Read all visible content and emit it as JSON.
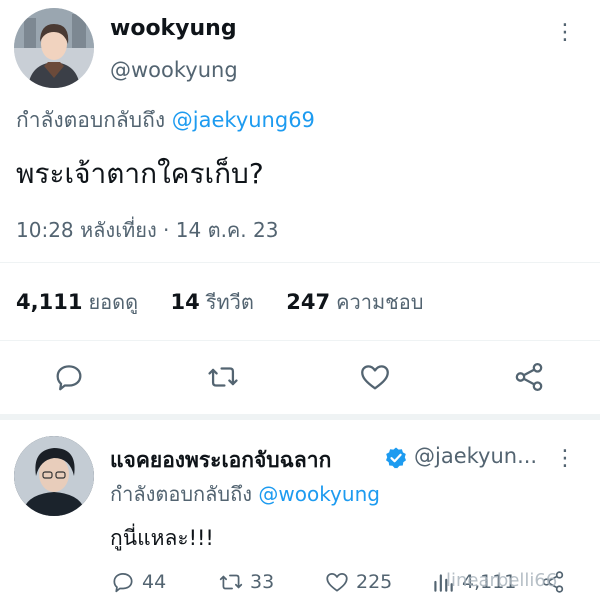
{
  "main_tweet": {
    "display_name": "wookyung",
    "handle": "@wookyung",
    "replying_prefix": "กำลังตอบกลับถึง",
    "replying_to": "@jaekyung69",
    "text": "พระเจ้าตากใครเก็บ?",
    "timestamp": "10:28 หลังเที่ยง · 14 ต.ค. 23",
    "stats": {
      "views_count": "4,111",
      "views_label": "ยอดดู",
      "retweets_count": "14",
      "retweets_label": "รีทวีต",
      "likes_count": "247",
      "likes_label": "ความชอบ"
    },
    "more_glyph": "⋮"
  },
  "reply_tweet": {
    "display_name": "แจคยองพระเอกจับฉลาก",
    "handle": "@jaekyun...",
    "replying_prefix": "กำลังตอบกลับถึง",
    "replying_to": "@wookyung",
    "text": "กูนี่แหละ!!!",
    "counts": {
      "replies": "44",
      "retweets": "33",
      "likes": "225",
      "views": "4,111"
    },
    "more_glyph": "⋮"
  },
  "watermark": "linearbelli66",
  "icons": [
    "reply-icon",
    "retweet-icon",
    "like-icon",
    "share-icon",
    "verified-badge-icon",
    "views-icon",
    "more-icon"
  ],
  "colors": {
    "link_blue": "#1d9bf0",
    "muted_gray": "#536471",
    "divider": "#eff3f4"
  }
}
